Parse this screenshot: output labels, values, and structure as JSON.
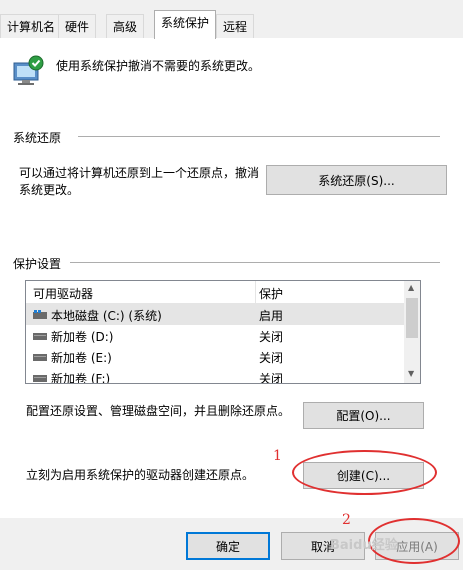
{
  "tabs": [
    {
      "label": "计算机名"
    },
    {
      "label": "硬件"
    },
    {
      "label": "高级"
    },
    {
      "label": "系统保护",
      "active": true
    },
    {
      "label": "远程"
    }
  ],
  "header": {
    "description": "使用系统保护撤消不需要的系统更改。",
    "icon": "system-protection-shield-icon"
  },
  "restore": {
    "group_title": "系统还原",
    "text": "可以通过将计算机还原到上一个还原点，撤消系统更改。",
    "button": "系统还原(S)..."
  },
  "protection": {
    "group_title": "保护设置",
    "columns": [
      "可用驱动器",
      "保护"
    ],
    "drives": [
      {
        "name": "本地磁盘 (C:) (系统)",
        "status": "启用",
        "icon": "system-drive-icon"
      },
      {
        "name": "新加卷 (D:)",
        "status": "关闭",
        "icon": "drive-icon"
      },
      {
        "name": "新加卷 (E:)",
        "status": "关闭",
        "icon": "drive-icon"
      },
      {
        "name": "新加卷 (F:)",
        "status": "关闭",
        "icon": "drive-icon"
      }
    ],
    "configure_text": "配置还原设置、管理磁盘空间，并且删除还原点。",
    "configure_button": "配置(O)...",
    "create_text": "立刻为启用系统保护的驱动器创建还原点。",
    "create_button": "创建(C)..."
  },
  "footer": {
    "ok": "确定",
    "cancel": "取消",
    "apply": "应用(A)"
  },
  "annotations": {
    "mark1": "1",
    "mark2": "2",
    "color": "#e03030"
  },
  "watermark": "Baidu经验"
}
